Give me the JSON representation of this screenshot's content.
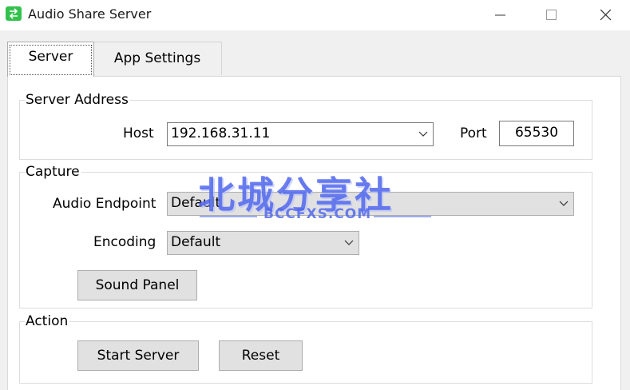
{
  "window": {
    "title": "Audio Share Server",
    "accent_color": "#33c24d"
  },
  "tabs": [
    {
      "label": "Server",
      "selected": true
    },
    {
      "label": "App Settings",
      "selected": false
    }
  ],
  "server_address": {
    "title": "Server Address",
    "host_label": "Host",
    "host_value": "192.168.31.11",
    "port_label": "Port",
    "port_value": "65530"
  },
  "capture": {
    "title": "Capture",
    "endpoint_label": "Audio Endpoint",
    "endpoint_value": "Default",
    "encoding_label": "Encoding",
    "encoding_value": "Default",
    "sound_panel_label": "Sound Panel"
  },
  "action": {
    "title": "Action",
    "start_label": "Start Server",
    "reset_label": "Reset"
  },
  "watermark": {
    "main_text": "北城分享社",
    "sub_text": "BCCFXS.COM"
  }
}
